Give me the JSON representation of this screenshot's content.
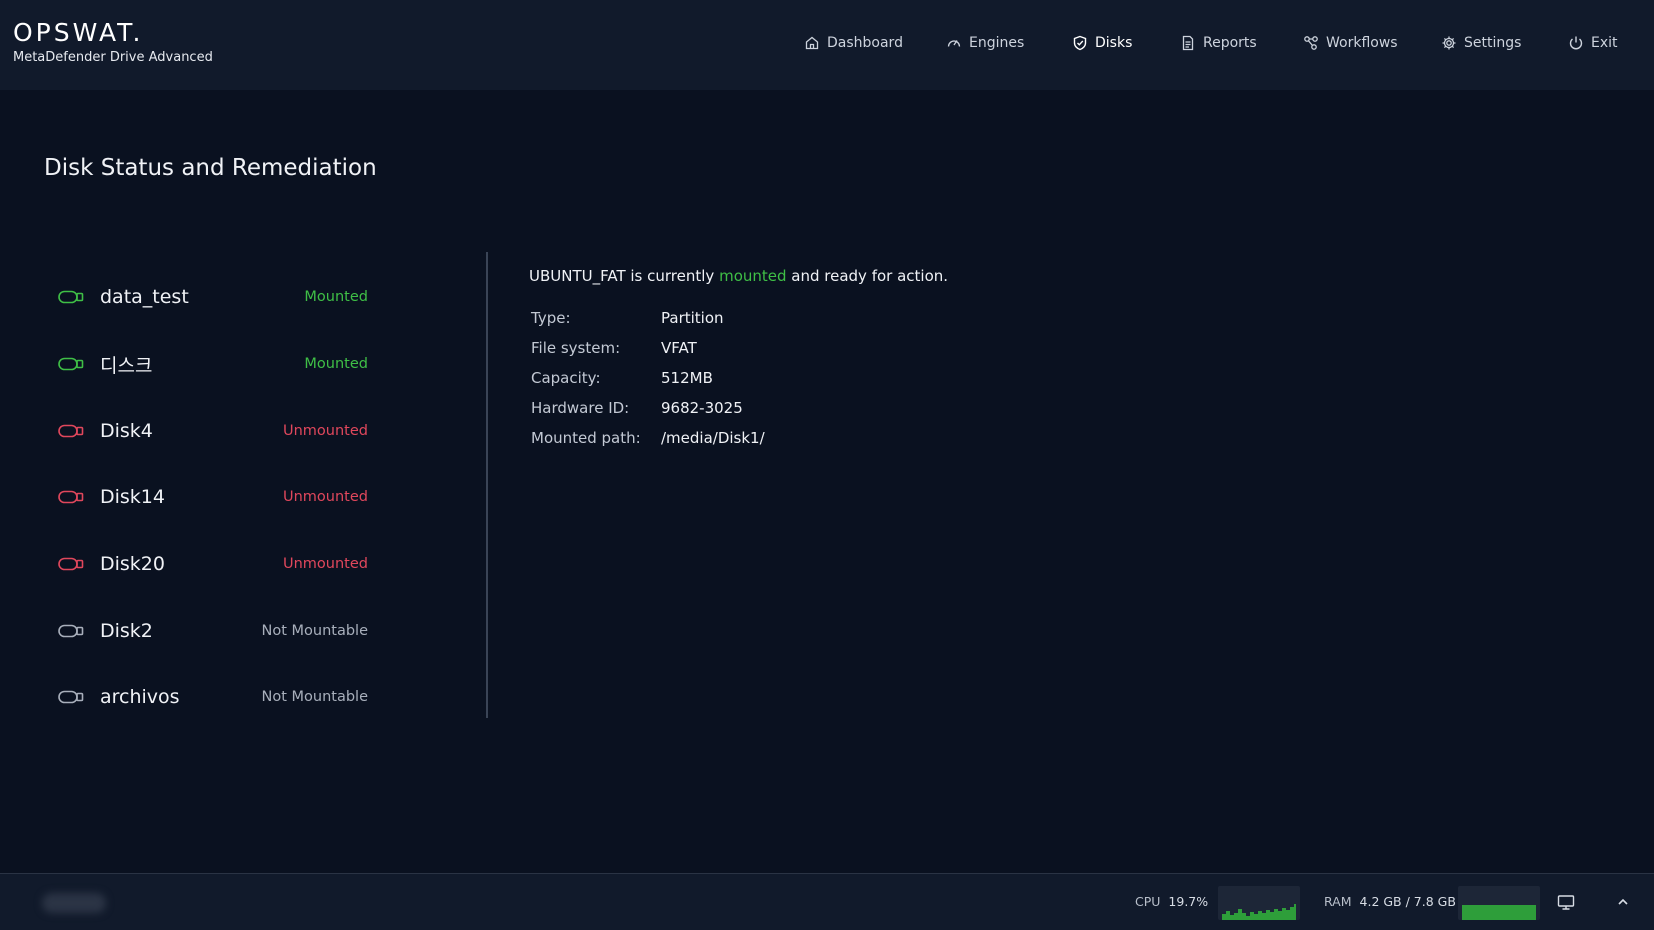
{
  "header": {
    "logo": "OPSWAT.",
    "product": "MetaDefender Drive Advanced",
    "nav": [
      {
        "label": "Dashboard",
        "icon": "home-icon"
      },
      {
        "label": "Engines",
        "icon": "gauge-icon"
      },
      {
        "label": "Disks",
        "icon": "shield-check-icon",
        "active": true
      },
      {
        "label": "Reports",
        "icon": "document-icon"
      },
      {
        "label": "Workflows",
        "icon": "workflow-icon"
      },
      {
        "label": "Settings",
        "icon": "gear-icon"
      },
      {
        "label": "Exit",
        "icon": "power-icon"
      }
    ]
  },
  "main": {
    "title": "Disk Status and Remediation",
    "disks": [
      {
        "name": "data_test",
        "status": "Mounted",
        "state": "mounted"
      },
      {
        "name": "디스크",
        "status": "Mounted",
        "state": "mounted"
      },
      {
        "name": "Disk4",
        "status": "Unmounted",
        "state": "unmounted"
      },
      {
        "name": "Disk14",
        "status": "Unmounted",
        "state": "unmounted"
      },
      {
        "name": "Disk20",
        "status": "Unmounted",
        "state": "unmounted"
      },
      {
        "name": "Disk2",
        "status": "Not Mountable",
        "state": "notmount"
      },
      {
        "name": "archivos",
        "status": "Not Mountable",
        "state": "notmount"
      }
    ],
    "detail": {
      "summary_prefix": "UBUNTU_FAT is currently ",
      "summary_highlight": "mounted",
      "summary_suffix": " and ready for action.",
      "props": [
        {
          "label": "Type:",
          "value": "Partition"
        },
        {
          "label": "File system:",
          "value": "VFAT"
        },
        {
          "label": "Capacity:",
          "value": "512MB"
        },
        {
          "label": "Hardware ID:",
          "value": "9682-3025"
        },
        {
          "label": "Mounted path:",
          "value": "/media/Disk1/"
        }
      ]
    }
  },
  "footer": {
    "cpu_label": "CPU",
    "cpu_value": "19.7%",
    "ram_label": "RAM",
    "ram_value": "4.2 GB / 7.8 GB"
  },
  "colors": {
    "mounted": "#3fbf46",
    "unmounted": "#e0475c",
    "notmount": "#a8afbb",
    "spark": "#2e9e3a"
  }
}
